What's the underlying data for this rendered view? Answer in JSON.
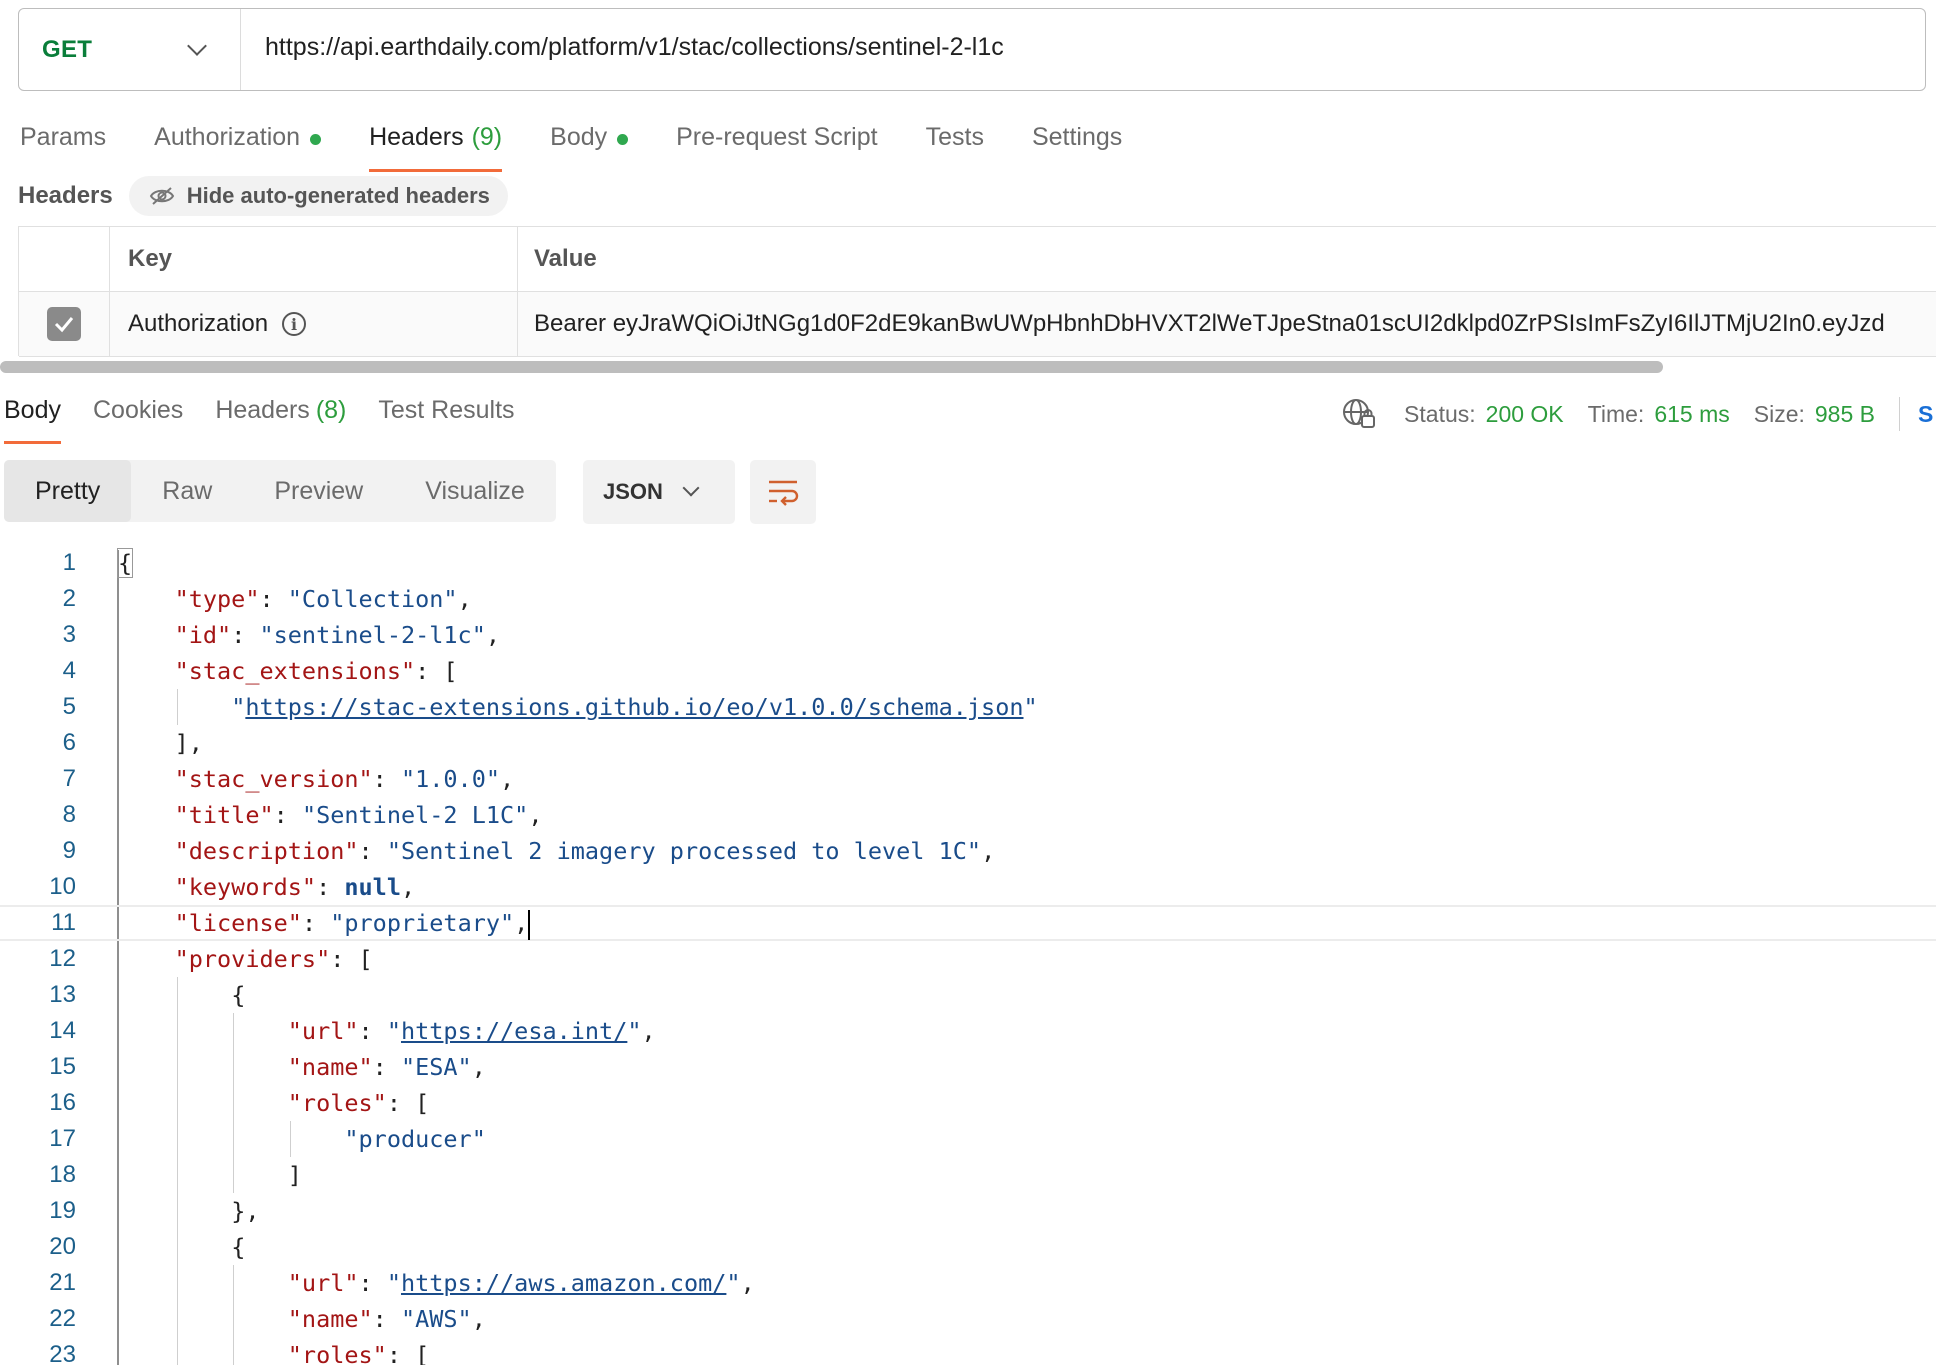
{
  "request": {
    "method": "GET",
    "url": "https://api.earthdaily.com/platform/v1/stac/collections/sentinel-2-l1c"
  },
  "request_tabs": [
    {
      "label": "Params",
      "active": false,
      "dot": false
    },
    {
      "label": "Authorization",
      "active": false,
      "dot": true
    },
    {
      "label": "Headers",
      "count": "(9)",
      "active": true,
      "dot": false
    },
    {
      "label": "Body",
      "active": false,
      "dot": true
    },
    {
      "label": "Pre-request Script",
      "active": false,
      "dot": false
    },
    {
      "label": "Tests",
      "active": false,
      "dot": false
    },
    {
      "label": "Settings",
      "active": false,
      "dot": false
    }
  ],
  "headers_section": {
    "title": "Headers",
    "hide_button": "Hide auto-generated headers",
    "columns": {
      "key": "Key",
      "value": "Value"
    },
    "rows": [
      {
        "checked": true,
        "key": "Authorization",
        "value": "Bearer eyJraWQiOiJtNGg1d0F2dE9kanBwUWpHbnhDbHVXT2lWeTJpeStna01scUI2dklpd0ZrPSIsImFsZyI6IlJTMjU2In0.eyJzd"
      }
    ]
  },
  "response_tabs": [
    {
      "label": "Body",
      "active": true
    },
    {
      "label": "Cookies",
      "active": false
    },
    {
      "label": "Headers",
      "count": "(8)",
      "active": false
    },
    {
      "label": "Test Results",
      "active": false
    }
  ],
  "response_status": {
    "status_label": "Status:",
    "status_value": "200 OK",
    "time_label": "Time:",
    "time_value": "615 ms",
    "size_label": "Size:",
    "size_value": "985 B",
    "save_link": "S"
  },
  "view_modes": [
    "Pretty",
    "Raw",
    "Preview",
    "Visualize"
  ],
  "active_view": "Pretty",
  "format_select": "JSON",
  "colors": {
    "accent": "#f26b3a",
    "success": "#2d9d3d",
    "method_get": "#0a7e3a",
    "json_key": "#a31515",
    "json_string": "#1a4c8a"
  },
  "code_lines": [
    {
      "n": "1",
      "indent": 0,
      "parts": [
        [
          "p",
          "{"
        ]
      ]
    },
    {
      "n": "2",
      "indent": 1,
      "parts": [
        [
          "k",
          "\"type\""
        ],
        [
          "p",
          ": "
        ],
        [
          "s",
          "\"Collection\""
        ],
        [
          "p",
          ","
        ]
      ]
    },
    {
      "n": "3",
      "indent": 1,
      "parts": [
        [
          "k",
          "\"id\""
        ],
        [
          "p",
          ": "
        ],
        [
          "s",
          "\"sentinel-2-l1c\""
        ],
        [
          "p",
          ","
        ]
      ]
    },
    {
      "n": "4",
      "indent": 1,
      "parts": [
        [
          "k",
          "\"stac_extensions\""
        ],
        [
          "p",
          ": ["
        ]
      ]
    },
    {
      "n": "5",
      "indent": 2,
      "parts": [
        [
          "s",
          "\""
        ],
        [
          "u",
          "https://stac-extensions.github.io/eo/v1.0.0/schema.json"
        ],
        [
          "s",
          "\""
        ]
      ]
    },
    {
      "n": "6",
      "indent": 1,
      "parts": [
        [
          "p",
          "],"
        ]
      ]
    },
    {
      "n": "7",
      "indent": 1,
      "parts": [
        [
          "k",
          "\"stac_version\""
        ],
        [
          "p",
          ": "
        ],
        [
          "s",
          "\"1.0.0\""
        ],
        [
          "p",
          ","
        ]
      ]
    },
    {
      "n": "8",
      "indent": 1,
      "parts": [
        [
          "k",
          "\"title\""
        ],
        [
          "p",
          ": "
        ],
        [
          "s",
          "\"Sentinel-2 L1C\""
        ],
        [
          "p",
          ","
        ]
      ]
    },
    {
      "n": "9",
      "indent": 1,
      "parts": [
        [
          "k",
          "\"description\""
        ],
        [
          "p",
          ": "
        ],
        [
          "s",
          "\"Sentinel 2 imagery processed to level 1C\""
        ],
        [
          "p",
          ","
        ]
      ]
    },
    {
      "n": "10",
      "indent": 1,
      "parts": [
        [
          "k",
          "\"keywords\""
        ],
        [
          "p",
          ": "
        ],
        [
          "n",
          "null"
        ],
        [
          "p",
          ","
        ]
      ]
    },
    {
      "n": "11",
      "indent": 1,
      "current": true,
      "parts": [
        [
          "k",
          "\"license\""
        ],
        [
          "p",
          ": "
        ],
        [
          "s",
          "\"proprietary\""
        ],
        [
          "p",
          ","
        ]
      ]
    },
    {
      "n": "12",
      "indent": 1,
      "parts": [
        [
          "k",
          "\"providers\""
        ],
        [
          "p",
          ": ["
        ]
      ]
    },
    {
      "n": "13",
      "indent": 2,
      "parts": [
        [
          "p",
          "{"
        ]
      ]
    },
    {
      "n": "14",
      "indent": 3,
      "parts": [
        [
          "k",
          "\"url\""
        ],
        [
          "p",
          ": "
        ],
        [
          "s",
          "\""
        ],
        [
          "u",
          "https://esa.int/"
        ],
        [
          "s",
          "\""
        ],
        [
          "p",
          ","
        ]
      ]
    },
    {
      "n": "15",
      "indent": 3,
      "parts": [
        [
          "k",
          "\"name\""
        ],
        [
          "p",
          ": "
        ],
        [
          "s",
          "\"ESA\""
        ],
        [
          "p",
          ","
        ]
      ]
    },
    {
      "n": "16",
      "indent": 3,
      "parts": [
        [
          "k",
          "\"roles\""
        ],
        [
          "p",
          ": ["
        ]
      ]
    },
    {
      "n": "17",
      "indent": 4,
      "parts": [
        [
          "s",
          "\"producer\""
        ]
      ]
    },
    {
      "n": "18",
      "indent": 3,
      "parts": [
        [
          "p",
          "]"
        ]
      ]
    },
    {
      "n": "19",
      "indent": 2,
      "parts": [
        [
          "p",
          "},"
        ]
      ]
    },
    {
      "n": "20",
      "indent": 2,
      "parts": [
        [
          "p",
          "{"
        ]
      ]
    },
    {
      "n": "21",
      "indent": 3,
      "parts": [
        [
          "k",
          "\"url\""
        ],
        [
          "p",
          ": "
        ],
        [
          "s",
          "\""
        ],
        [
          "u",
          "https://aws.amazon.com/"
        ],
        [
          "s",
          "\""
        ],
        [
          "p",
          ","
        ]
      ]
    },
    {
      "n": "22",
      "indent": 3,
      "parts": [
        [
          "k",
          "\"name\""
        ],
        [
          "p",
          ": "
        ],
        [
          "s",
          "\"AWS\""
        ],
        [
          "p",
          ","
        ]
      ]
    },
    {
      "n": "23",
      "indent": 3,
      "parts": [
        [
          "k",
          "\"roles\""
        ],
        [
          "p",
          ": ["
        ]
      ]
    }
  ]
}
